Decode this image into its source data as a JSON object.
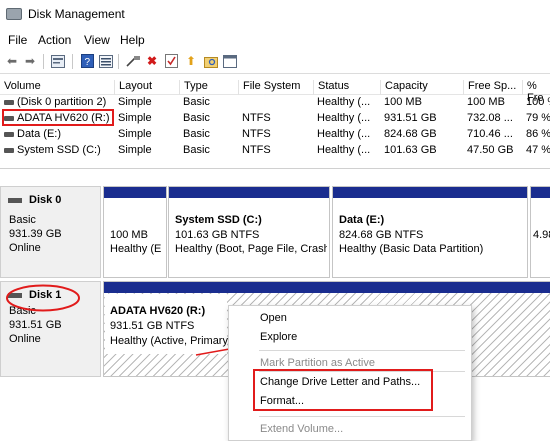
{
  "window": {
    "title": "Disk Management"
  },
  "menu": [
    "File",
    "Action",
    "View",
    "Help"
  ],
  "toolbar": {
    "back_glyph": "⬅",
    "forward_glyph": "➡",
    "delete_glyph": "✖",
    "up_glyph": "⬆"
  },
  "volume_table": {
    "headers": [
      "Volume",
      "Layout",
      "Type",
      "File System",
      "Status",
      "Capacity",
      "Free Sp...",
      "% Fre"
    ],
    "rows": [
      [
        "(Disk 0 partition 2)",
        "Simple",
        "Basic",
        "",
        "Healthy (...",
        "100 MB",
        "100 MB",
        "100 %"
      ],
      [
        "ADATA HV620 (R:)",
        "Simple",
        "Basic",
        "NTFS",
        "Healthy (...",
        "931.51 GB",
        "732.08 ...",
        "79 %"
      ],
      [
        "Data (E:)",
        "Simple",
        "Basic",
        "NTFS",
        "Healthy (...",
        "824.68 GB",
        "710.46 ...",
        "86 %"
      ],
      [
        "System SSD (C:)",
        "Simple",
        "Basic",
        "NTFS",
        "Healthy (...",
        "101.63 GB",
        "47.50 GB",
        "47 %"
      ]
    ]
  },
  "disks": [
    {
      "name": "Disk 0",
      "type": "Basic",
      "size": "931.39 GB",
      "status": "Online",
      "partitions": [
        {
          "title": "",
          "line1": "100 MB",
          "line2": "Healthy (E"
        },
        {
          "title": "System SSD  (C:)",
          "line1": "101.63 GB NTFS",
          "line2": "Healthy (Boot, Page File, Crash"
        },
        {
          "title": "Data  (E:)",
          "line1": "824.68 GB NTFS",
          "line2": "Healthy (Basic Data Partition)"
        },
        {
          "title": "",
          "line1": "4.98",
          "line2": ""
        }
      ]
    },
    {
      "name": "Disk 1",
      "type": "Basic",
      "size": "931.51 GB",
      "status": "Online",
      "partitions": [
        {
          "title": "ADATA HV620  (R:)",
          "line1": "931.51 GB NTFS",
          "line2": "Healthy (Active, Primary"
        }
      ]
    }
  ],
  "context_menu": {
    "items": [
      {
        "label": "Open",
        "enabled": true
      },
      {
        "label": "Explore",
        "enabled": true
      },
      {
        "label": "Mark Partition as Active",
        "enabled": false
      },
      {
        "label": "Change Drive Letter and Paths...",
        "enabled": true
      },
      {
        "label": "Format...",
        "enabled": true
      },
      {
        "label": "Extend Volume...",
        "enabled": false
      }
    ]
  },
  "colors": {
    "annotation_red": "#e11b1b",
    "partition_bar": "#1a2d8f"
  }
}
